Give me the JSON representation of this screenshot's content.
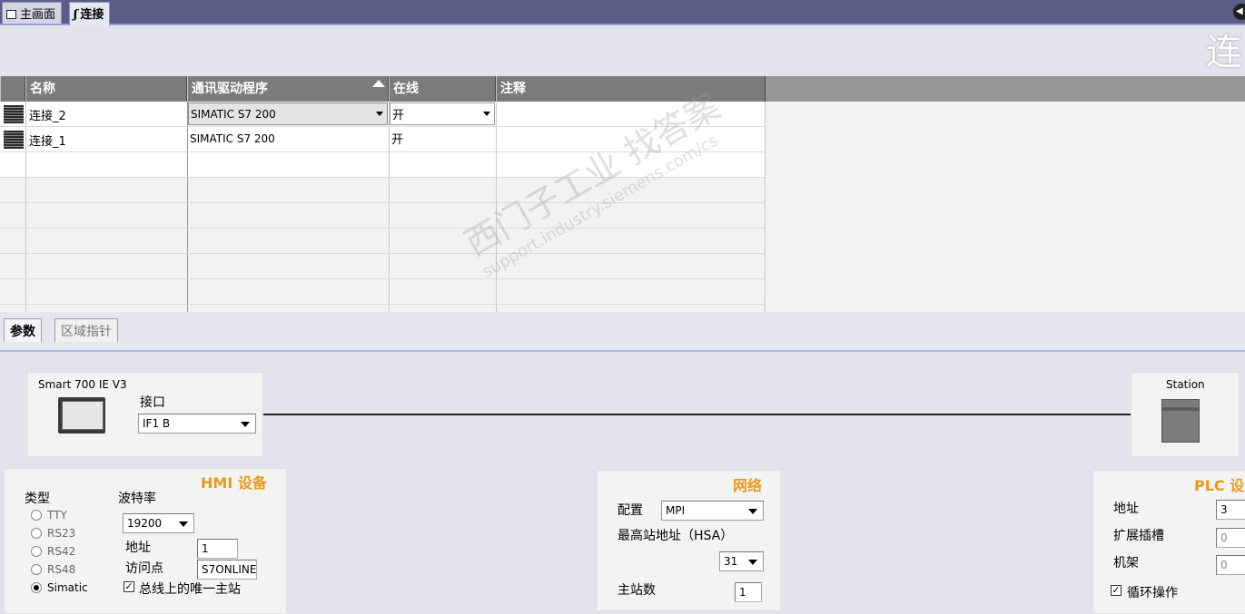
{
  "top_tabs": [
    {
      "label": "主画面",
      "icon": "screen-icon"
    },
    {
      "label": "连接",
      "icon": "connection-icon",
      "active": true
    }
  ],
  "page_title": "连",
  "table": {
    "headers": [
      "名称",
      "通讯驱动程序",
      "在线",
      "注释"
    ],
    "rows": [
      {
        "name": "连接_2",
        "driver": "SIMATIC S7 200",
        "online": "开",
        "comment": ""
      },
      {
        "name": "连接_1",
        "driver": "SIMATIC S7 200",
        "online": "开",
        "comment": ""
      }
    ]
  },
  "lower_tabs": [
    "参数",
    "区域指针"
  ],
  "hmi_device": {
    "device_name": "Smart 700 IE V3",
    "interface_label": "接口",
    "interface_value": "IF1 B",
    "section_title": "HMI 设备",
    "type_label": "类型",
    "types": [
      "TTY",
      "RS23",
      "RS42",
      "RS48",
      "Simatic"
    ],
    "selected_type": "Simatic",
    "baud_label": "波特率",
    "baud_value": "19200",
    "address_label": "地址",
    "address_value": "1",
    "access_point_label": "访问点",
    "access_point_value": "S7ONLINE",
    "only_master_label": "总线上的唯一主站",
    "only_master_checked": true
  },
  "network": {
    "section_title": "网络",
    "profile_label": "配置",
    "profile_value": "MPI",
    "hsa_label": "最高站地址（HSA）",
    "hsa_value": "31",
    "masters_label": "主站数",
    "masters_value": "1"
  },
  "plc_device": {
    "station_label": "Station",
    "section_title": "PLC 设",
    "address_label": "地址",
    "address_value": "3",
    "ext_slot_label": "扩展插槽",
    "ext_slot_value": "0",
    "rack_label": "机架",
    "rack_value": "0",
    "cyclic_label": "循环操作",
    "cyclic_checked": true
  },
  "watermark": {
    "line1": "西门子工业  找答案",
    "line2": "support.industry.siemens.com/cs"
  },
  "colors": {
    "tab_bar": "#5c5d87",
    "header": "#7b7b7b",
    "section_title": "#e69a1d"
  }
}
